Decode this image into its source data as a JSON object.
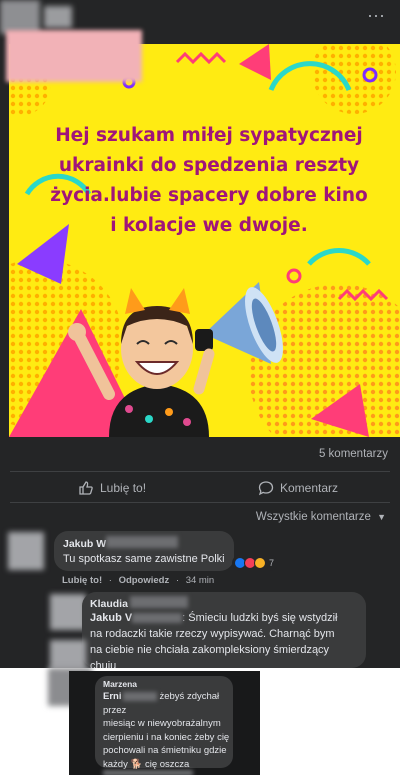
{
  "post": {
    "more_icon": "more-horizontal-icon",
    "image": {
      "text": "Hej szukam miłej sypatycznej ukrainki do spedzenia reszty życia.lubie spacery dobre kino i kolacje we dwoje.",
      "lines": [
        "Hej szukam miłej sypatycznej",
        "ukrainki do spedzenia reszty",
        "życia.lubie spacery dobre kino",
        "i kolacje we dwoje."
      ],
      "background_color": "#ffeb12",
      "text_color": "#a0157a"
    },
    "comments_count": "5 komentarzy"
  },
  "actions": {
    "like_label": "Lubię to!",
    "comment_label": "Komentarz"
  },
  "sort_label": "Wszystkie komentarze",
  "comments": [
    {
      "author": "Jakub",
      "author_suffix": "W",
      "text": "Tu spotkasz same zawistne Polki",
      "reaction_count": "7",
      "like": "Lubię to!",
      "reply": "Odpowiedz",
      "time": "34 min"
    },
    {
      "author": "Klaudia",
      "mention": "Jakub V",
      "text_after_mention": "ː Śmieciu ludzki byś się wstydził",
      "lines": [
        "na rodaczki takie rzeczy wypisywać. Charnąć bym",
        "na ciebie nie chciała zakompleksiony śmierdzący",
        "chuju"
      ]
    }
  ],
  "overlay_comment": {
    "author": "Marzena",
    "mention": "Erni",
    "first": "żebyś zdychał przez",
    "lines": [
      "miesiąc w niewyobrażalnym",
      "cierpieniu i na koniec żeby cię",
      "pochowali na śmietniku gdzie"
    ],
    "last_before": "każdy",
    "last_after": "cię oszcza",
    "dog_icon": "dog-emoji-icon"
  },
  "colors": {
    "background": "#18191a",
    "card": "#242526",
    "bubble": "#3a3b3c",
    "text": "#e4e6eb",
    "muted": "#b0b3b8",
    "accent_like": "#1877f2"
  }
}
